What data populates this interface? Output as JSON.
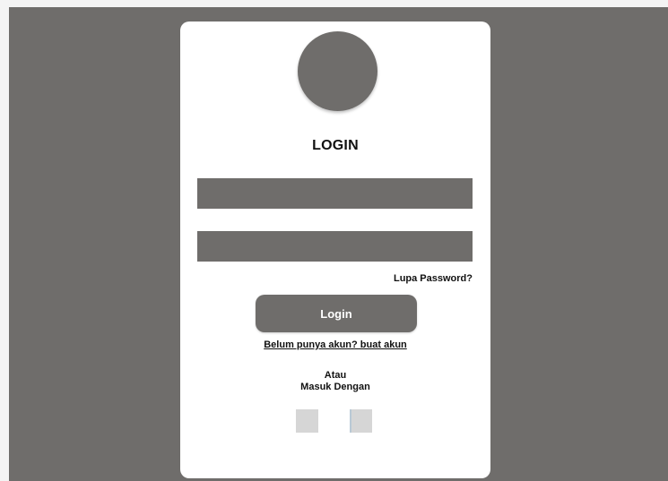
{
  "login": {
    "title": "LOGIN",
    "username_value": "",
    "password_value": "",
    "forgot_password": "Lupa Password?",
    "login_button": "Login",
    "register_link": "Belum punya akun? buat akun",
    "alt_line1": "Atau",
    "alt_line2": "Masuk Dengan",
    "social_buttons": [
      {
        "name": "social-login-option-1"
      },
      {
        "name": "social-login-option-2"
      }
    ]
  },
  "colors": {
    "backdrop": "#6f6d6b",
    "card": "#ffffff",
    "placeholder_block": "#6f6d6b",
    "social_icon": "#d6d6d6"
  }
}
